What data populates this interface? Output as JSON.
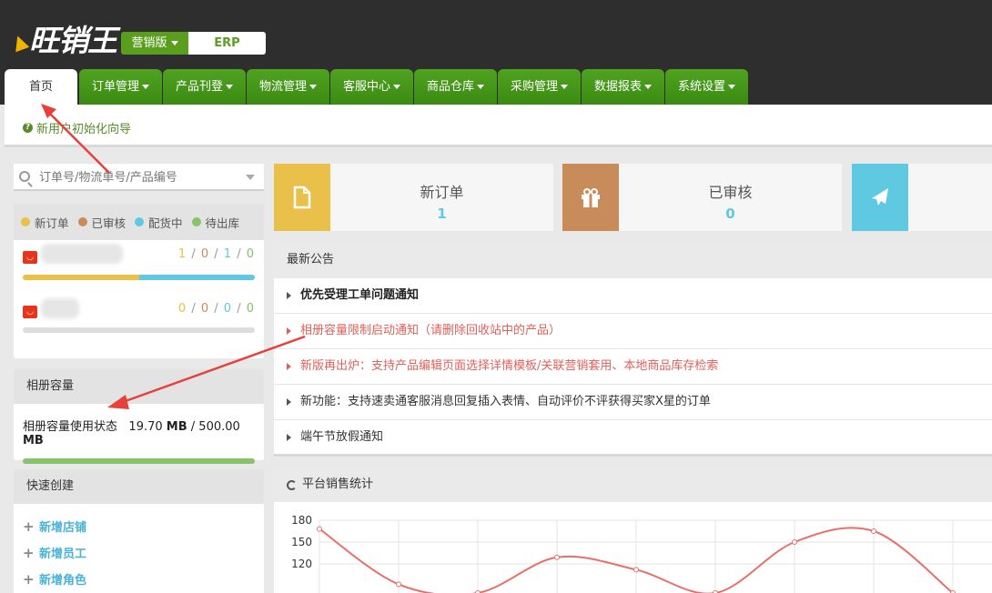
{
  "brand": {
    "logo_text": "旺销王",
    "edition": "营销版",
    "erp": "ERP"
  },
  "nav": {
    "home": "首页",
    "tabs": [
      "订单管理",
      "产品刊登",
      "物流管理",
      "客服中心",
      "商品仓库",
      "采购管理",
      "数据报表",
      "系统设置"
    ]
  },
  "guide": {
    "label": "新用户初始化向导"
  },
  "search": {
    "placeholder": "订单号/物流单号/产品编号"
  },
  "legend": [
    {
      "label": "新订单",
      "color": "#e9c04a"
    },
    {
      "label": "已审核",
      "color": "#c88c5a"
    },
    {
      "label": "配货中",
      "color": "#5ec9e0"
    },
    {
      "label": "待出库",
      "color": "#86c36a"
    }
  ],
  "stores": [
    {
      "counts": [
        "1",
        "0",
        "1",
        "0"
      ],
      "progress": {
        "new": 0.5,
        "shipping": 0.5
      }
    },
    {
      "counts": [
        "0",
        "0",
        "0",
        "0"
      ],
      "progress": {
        "new": 0,
        "shipping": 0
      }
    }
  ],
  "album": {
    "title": "相册容量",
    "label": "相册容量使用状态",
    "used": "19.70",
    "total": "500.00",
    "unit": "MB",
    "usage_fraction": 1.0
  },
  "quick_create": {
    "title": "快速创建",
    "items": [
      "新增店铺",
      "新增员工",
      "新增角色"
    ]
  },
  "stats": [
    {
      "label": "新订单",
      "value": "1",
      "color": "#e9c04a",
      "icon": "document-icon"
    },
    {
      "label": "已审核",
      "value": "0",
      "color": "#c88c5a",
      "icon": "gift-icon"
    },
    {
      "label": "",
      "value": "",
      "color": "#5ec9e0",
      "icon": "plane-icon"
    }
  ],
  "notices": {
    "title": "最新公告",
    "items": [
      {
        "text": "优先受理工单问题通知",
        "style": "bold"
      },
      {
        "text": "相册容量限制启动通知（请删除回收站中的产品）",
        "style": "red"
      },
      {
        "text": "新版再出炉：支持产品编辑页面选择详情模板/关联营销套用、本地商品库存检索",
        "style": "red"
      },
      {
        "text": "新功能：支持速卖通客服消息回复插入表情、自动评价不评获得买家X星的订单",
        "style": "normal"
      },
      {
        "text": "端午节放假通知",
        "style": "normal"
      }
    ]
  },
  "chart_data": {
    "type": "line",
    "title": "平台销售统计",
    "y_ticks": [
      "180",
      "150",
      "120"
    ],
    "ylim": [
      90,
      180
    ],
    "x": [
      0,
      1,
      2,
      3,
      4,
      5,
      6,
      7,
      8
    ],
    "series": [
      {
        "values": [
          168,
          92,
          80,
          129,
          112,
          80,
          150,
          165,
          80
        ]
      }
    ],
    "grid": true,
    "line_color": "#e8706a"
  }
}
